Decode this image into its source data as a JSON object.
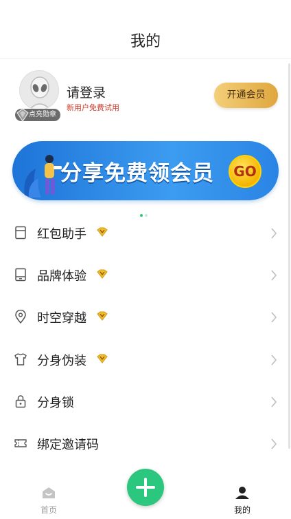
{
  "header": {
    "title": "我的"
  },
  "profile": {
    "login_label": "请登录",
    "trial_label": "新用户免费试用",
    "medal_label": "点亮勋章",
    "vip_button_label": "开通会员"
  },
  "banner": {
    "text": "分享免费领会员",
    "go_label": "GO",
    "dots_total": 2,
    "dots_active": 1
  },
  "menu": {
    "items": [
      {
        "label": "红包助手",
        "icon": "red-packet-icon",
        "vip_badge": true
      },
      {
        "label": "品牌体验",
        "icon": "phone-icon",
        "vip_badge": true
      },
      {
        "label": "时空穿越",
        "icon": "location-pin-icon",
        "vip_badge": true
      },
      {
        "label": "分身伪装",
        "icon": "shirt-icon",
        "vip_badge": true
      },
      {
        "label": "分身锁",
        "icon": "lock-icon",
        "vip_badge": false
      },
      {
        "label": "绑定邀请码",
        "icon": "ticket-icon",
        "vip_badge": false
      }
    ]
  },
  "tabbar": {
    "home_label": "首页",
    "mine_label": "我的",
    "add_icon": "plus-icon",
    "active_tab": "我的"
  },
  "colors": {
    "accent_green": "#2bc77e",
    "vip_gold": "#e7b34b",
    "banner_blue": "#2f8ae6",
    "trial_red": "#d23b2b"
  }
}
